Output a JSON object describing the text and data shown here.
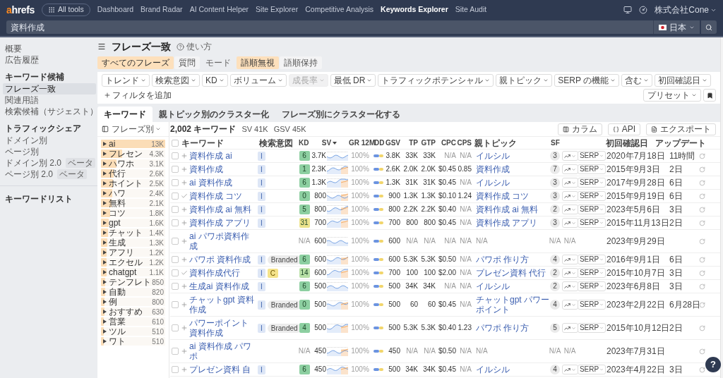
{
  "nav": {
    "logo": {
      "accent": "a",
      "rest": "hrefs"
    },
    "all_tools": "All tools",
    "links": [
      {
        "label": "Dashboard",
        "selected": false
      },
      {
        "label": "Brand Radar",
        "selected": false
      },
      {
        "label": "AI Content Helper",
        "selected": false
      },
      {
        "label": "Site Explorer",
        "selected": false
      },
      {
        "label": "Competitive Analysis",
        "selected": false
      },
      {
        "label": "Keywords Explorer",
        "selected": true
      },
      {
        "label": "Site Audit",
        "selected": false
      }
    ],
    "account": "株式会社Cone"
  },
  "search": {
    "value": "資料作成",
    "country": "日本"
  },
  "sidebar": {
    "items": [
      {
        "label": "概要",
        "selected": false
      },
      {
        "label": "広告履歴",
        "selected": false
      }
    ],
    "sections": [
      {
        "heading": "キーワード候補",
        "items": [
          {
            "label": "フレーズ一致",
            "selected": true
          },
          {
            "label": "関連用語",
            "selected": false
          },
          {
            "label": "検索候補（サジェスト）",
            "selected": false
          }
        ]
      },
      {
        "heading": "トラフィックシェア",
        "items": [
          {
            "label": "ドメイン別",
            "selected": false
          },
          {
            "label": "ページ別",
            "selected": false
          },
          {
            "label": "ドメイン別 2.0",
            "badge": "ベータ",
            "selected": false
          },
          {
            "label": "ページ別 2.0",
            "badge": "ベータ",
            "selected": false
          }
        ]
      },
      {
        "heading": "キーワードリスト"
      }
    ]
  },
  "page": {
    "title": "フレーズ一致",
    "help": "使い方"
  },
  "match_toggle": [
    {
      "label": "すべてのフレーズ",
      "selected": true
    },
    {
      "label": "質問",
      "selected": false
    }
  ],
  "mode_label": "モード",
  "order_toggle": [
    {
      "label": "語順無視",
      "selected": true
    },
    {
      "label": "語順保持",
      "selected": false
    }
  ],
  "filters": [
    {
      "label": "トレンド",
      "disabled": false
    },
    {
      "label": "検索意図",
      "disabled": false
    },
    {
      "label": "KD",
      "disabled": false
    },
    {
      "label": "ボリューム",
      "disabled": false
    },
    {
      "label": "成長率",
      "disabled": true
    },
    {
      "label": "最低 DR",
      "disabled": false
    },
    {
      "label": "トラフィックポテンシャル",
      "disabled": false
    },
    {
      "label": "親トピック",
      "disabled": false
    },
    {
      "label": "SERP の機能",
      "disabled": false
    },
    {
      "label": "含む",
      "disabled": false
    },
    {
      "label": "初回確認日",
      "disabled": false
    }
  ],
  "add_filter": "フィルタを追加",
  "preset": "プリセット",
  "tabs": [
    {
      "label": "キーワード",
      "selected": true
    },
    {
      "label": "親トピック別のクラスター化",
      "selected": false
    },
    {
      "label": "フレーズ別にクラスター化する",
      "selected": false
    }
  ],
  "phrase_panel": {
    "header": "フレーズ別",
    "items": [
      {
        "label": "ai",
        "count": "13K",
        "level": 1
      },
      {
        "label": "フレセン",
        "count": "4.3K",
        "level": 0.33
      },
      {
        "label": "ハワホ",
        "count": "3.1K",
        "level": 0.24
      },
      {
        "label": "代行",
        "count": "2.6K",
        "level": 0.2
      },
      {
        "label": "ホイント",
        "count": "2.5K",
        "level": 0.19
      },
      {
        "label": "ハワ",
        "count": "2.4K",
        "level": 0.18
      },
      {
        "label": "無料",
        "count": "2.1K",
        "level": 0.16
      },
      {
        "label": "コツ",
        "count": "1.8K",
        "level": 0.14
      },
      {
        "label": "gpt",
        "count": "1.6K",
        "level": 0.12
      },
      {
        "label": "チャット",
        "count": "1.4K",
        "level": 0.11
      },
      {
        "label": "生成",
        "count": "1.3K",
        "level": 0.1
      },
      {
        "label": "アフリ",
        "count": "1.2K",
        "level": 0.09
      },
      {
        "label": "エクセル",
        "count": "1.2K",
        "level": 0.09
      },
      {
        "label": "chatgpt",
        "count": "1.1K",
        "level": 0.085
      },
      {
        "label": "テンフレト",
        "count": "850",
        "level": 0.065
      },
      {
        "label": "自動",
        "count": "820",
        "level": 0.063
      },
      {
        "label": "例",
        "count": "800",
        "level": 0.06
      },
      {
        "label": "おすすめ",
        "count": "630",
        "level": 0.05
      },
      {
        "label": "営業",
        "count": "610",
        "level": 0.047
      },
      {
        "label": "ツル",
        "count": "510",
        "level": 0.04
      },
      {
        "label": "ワト",
        "count": "510",
        "level": 0.04
      }
    ]
  },
  "table": {
    "select_all": {
      "checked": false
    },
    "summary": {
      "count": "2,002 キーワード",
      "sv": "SV 41K",
      "gsv": "GSV 45K"
    },
    "buttons": [
      {
        "label": "カラム",
        "kind": "columns"
      },
      {
        "label": "API",
        "kind": "api"
      },
      {
        "label": "エクスポート",
        "kind": "export"
      }
    ],
    "columns": [
      {
        "label": "キーワード",
        "sorted": false
      },
      {
        "label": "検索意図",
        "sorted": false
      },
      {
        "label": "KD",
        "sorted": false
      },
      {
        "label": "SV",
        "sorted": true
      },
      {
        "label": "GR 12M",
        "sorted": false
      },
      {
        "label": "DD",
        "sorted": false
      },
      {
        "label": "GSV",
        "sorted": false
      },
      {
        "label": "TP",
        "sorted": false
      },
      {
        "label": "GTP",
        "sorted": false
      },
      {
        "label": "CPC",
        "sorted": false
      },
      {
        "label": "CPS",
        "sorted": false
      },
      {
        "label": "親トピック",
        "sorted": false
      },
      {
        "label": "SF",
        "sorted": false
      },
      {
        "label": "初回確認日",
        "sorted": false
      },
      {
        "label": "アップデート",
        "sorted": false
      }
    ],
    "rows": [
      {
        "checked": false,
        "added": false,
        "keyword": "資料作成 ai",
        "intents": [
          {
            "label": "I",
            "kind": "informational"
          }
        ],
        "kd": {
          "value": "6",
          "color": "#8dcfa1"
        },
        "sv": "3.7K",
        "forecast": false,
        "gr12m": "100%",
        "gsv": "3.8K",
        "tp": "33K",
        "gtp": "33K",
        "cpc": "N/A",
        "cps": "N/A",
        "parent_topic": "イルシル",
        "sf": "3",
        "serp": "SERP",
        "first_seen": "2020年7月18日",
        "updated": "11時間",
        "muted": {
          "cpc": true,
          "cps": true
        }
      },
      {
        "checked": false,
        "added": false,
        "keyword": "資料作成",
        "intents": [
          {
            "label": "I",
            "kind": "informational"
          }
        ],
        "kd": {
          "value": "1",
          "color": "#8dcfa1"
        },
        "sv": "2.3K",
        "forecast": true,
        "gr12m": "100%",
        "gsv": "2.6K",
        "tp": "2.0K",
        "gtp": "2.0K",
        "cpc": "$0.45",
        "cps": "0.85",
        "parent_topic": "資料作成",
        "sf": "7",
        "serp": "SERP",
        "first_seen": "2015年9月3日",
        "updated": "2日"
      },
      {
        "checked": false,
        "added": false,
        "keyword": "ai 資料作成",
        "intents": [
          {
            "label": "I",
            "kind": "informational"
          }
        ],
        "kd": {
          "value": "6",
          "color": "#8dcfa1"
        },
        "sv": "1.3K",
        "forecast": true,
        "gr12m": "100%",
        "gsv": "1.3K",
        "tp": "31K",
        "gtp": "31K",
        "cpc": "$0.45",
        "cps": "N/A",
        "parent_topic": "イルシル",
        "sf": "3",
        "serp": "SERP",
        "first_seen": "2017年9月28日",
        "updated": "6日",
        "muted": {
          "cps": true
        }
      },
      {
        "checked": false,
        "added": true,
        "keyword": "資料作成 コツ",
        "intents": [
          {
            "label": "I",
            "kind": "informational"
          }
        ],
        "kd": {
          "value": "0",
          "color": "#8dcfa1"
        },
        "sv": "800",
        "forecast": true,
        "gr12m": "100%",
        "gsv": "900",
        "tp": "1.3K",
        "gtp": "1.3K",
        "cpc": "$0.10",
        "cps": "1.24",
        "parent_topic": "資料作成 コツ",
        "sf": "3",
        "serp": "SERP",
        "first_seen": "2015年9月19日",
        "updated": "6日"
      },
      {
        "checked": false,
        "added": false,
        "keyword": "資料作成 ai 無料",
        "intents": [
          {
            "label": "I",
            "kind": "informational"
          }
        ],
        "kd": {
          "value": "5",
          "color": "#8dcfa1"
        },
        "sv": "800",
        "forecast": true,
        "gr12m": "100%",
        "gsv": "800",
        "tp": "2.2K",
        "gtp": "2.2K",
        "cpc": "$0.40",
        "cps": "N/A",
        "parent_topic": "資料作成 ai 無料",
        "sf": "2",
        "serp": "SERP",
        "first_seen": "2023年5月6日",
        "updated": "3日",
        "muted": {
          "cps": true
        }
      },
      {
        "checked": false,
        "added": false,
        "keyword": "資料作成 アプリ",
        "intents": [
          {
            "label": "I",
            "kind": "informational"
          }
        ],
        "kd": {
          "value": "31",
          "color": "#ece38c"
        },
        "sv": "700",
        "forecast": true,
        "gr12m": "100%",
        "gsv": "700",
        "tp": "800",
        "gtp": "800",
        "cpc": "$0.45",
        "cps": "N/A",
        "parent_topic": "資料作成 アプリ",
        "sf": "3",
        "serp": "SERP",
        "first_seen": "2015年11月13日",
        "updated": "2日",
        "muted": {
          "cps": true
        }
      },
      {
        "checked": false,
        "added": false,
        "keyword": "ai パワポ資料作成",
        "kd": {
          "value": "N/A"
        },
        "sv": "600",
        "forecast": false,
        "gr12m": "100%",
        "gsv": "600",
        "tp": "N/A",
        "gtp": "N/A",
        "cpc": "N/A",
        "cps": "N/A",
        "parent_topic": "N/A",
        "sf": "N/A",
        "trend_text": "N/A",
        "first_seen": "2023年9月29日",
        "muted": {
          "tp": true,
          "gtp": true,
          "cpc": true,
          "cps": true,
          "parent_topic": true,
          "sf": true
        }
      },
      {
        "checked": false,
        "added": false,
        "keyword": "パワポ 資料作成",
        "intents": [
          {
            "label": "I",
            "kind": "informational"
          },
          {
            "label": "Branded",
            "kind": "branded"
          }
        ],
        "kd": {
          "value": "6",
          "color": "#8dcfa1"
        },
        "sv": "600",
        "forecast": true,
        "gr12m": "100%",
        "gsv": "600",
        "tp": "5.3K",
        "gtp": "5.3K",
        "cpc": "$0.50",
        "cps": "N/A",
        "parent_topic": "パワポ 作り方",
        "sf": "4",
        "serp": "SERP",
        "first_seen": "2016年9月1日",
        "updated": "6日",
        "muted": {
          "cps": true
        }
      },
      {
        "checked": false,
        "added": true,
        "keyword": "資料作成代行",
        "intents": [
          {
            "label": "I",
            "kind": "informational"
          },
          {
            "label": "C",
            "kind": "commercial"
          }
        ],
        "kd": {
          "value": "14",
          "color": "#b8e0a6"
        },
        "sv": "600",
        "forecast": true,
        "gr12m": "100%",
        "gsv": "700",
        "tp": "100",
        "gtp": "100",
        "cpc": "$2.00",
        "cps": "N/A",
        "parent_topic": "プレゼン資料 代行",
        "sf": "2",
        "serp": "SERP",
        "first_seen": "2015年10月7日",
        "updated": "3日",
        "muted": {
          "cps": true
        }
      },
      {
        "checked": false,
        "added": false,
        "keyword": "生成ai 資料作成",
        "intents": [
          {
            "label": "I",
            "kind": "informational"
          }
        ],
        "kd": {
          "value": "6",
          "color": "#8dcfa1"
        },
        "sv": "500",
        "forecast": false,
        "gr12m": "100%",
        "gsv": "500",
        "tp": "34K",
        "gtp": "34K",
        "cpc": "N/A",
        "cps": "N/A",
        "parent_topic": "イルシル",
        "sf": "2",
        "serp": "SERP",
        "first_seen": "2023年6月8日",
        "updated": "3日",
        "muted": {
          "cpc": true,
          "cps": true
        }
      },
      {
        "checked": false,
        "added": false,
        "keyword": "チャットgpt 資料作成",
        "intents": [
          {
            "label": "I",
            "kind": "informational"
          },
          {
            "label": "Branded",
            "kind": "branded"
          }
        ],
        "kd": {
          "value": "0",
          "color": "#8dcfa1"
        },
        "sv": "500",
        "forecast": true,
        "gr12m": "100%",
        "gsv": "500",
        "tp": "60",
        "gtp": "60",
        "cpc": "$0.45",
        "cps": "N/A",
        "parent_topic": "チャットgpt パワーポイント",
        "sf": "4",
        "serp": "SERP",
        "first_seen": "2023年2月22日",
        "updated": "6月28日",
        "muted": {
          "cps": true
        }
      },
      {
        "checked": false,
        "added": false,
        "keyword": "パワーポイント資料作成",
        "intents": [
          {
            "label": "I",
            "kind": "informational"
          },
          {
            "label": "Branded",
            "kind": "branded"
          }
        ],
        "kd": {
          "value": "4",
          "color": "#8dcfa1"
        },
        "sv": "500",
        "forecast": true,
        "gr12m": "100%",
        "gsv": "500",
        "tp": "5.3K",
        "gtp": "5.3K",
        "cpc": "$0.40",
        "cps": "1.23",
        "parent_topic": "パワポ 作り方",
        "sf": "5",
        "serp": "SERP",
        "first_seen": "2015年10月12日",
        "updated": "2日"
      },
      {
        "checked": false,
        "added": false,
        "keyword": "ai 資料作成 パワポ",
        "kd": {
          "value": "N/A"
        },
        "sv": "450",
        "forecast": true,
        "gr12m": "100%",
        "gsv": "450",
        "tp": "N/A",
        "gtp": "N/A",
        "cpc": "$0.50",
        "cps": "N/A",
        "parent_topic": "N/A",
        "sf": "N/A",
        "trend_text": "N/A",
        "first_seen": "2023年7月31日",
        "muted": {
          "tp": true,
          "gtp": true,
          "cps": true,
          "parent_topic": true,
          "sf": true
        }
      },
      {
        "checked": false,
        "added": false,
        "keyword": "プレゼン資料 自",
        "intents": [
          {
            "label": "I",
            "kind": "informational"
          }
        ],
        "kd": {
          "value": "6",
          "color": "#8dcfa1"
        },
        "sv": "450",
        "forecast": true,
        "gr12m": "100%",
        "gsv": "500",
        "tp": "34K",
        "gtp": "34K",
        "cpc": "$0.45",
        "cps": "N/A",
        "parent_topic": "イルシル",
        "sf": "4",
        "serp": "SERP",
        "first_seen": "2023年4月22日",
        "updated": "3日",
        "muted": {
          "cps": true
        }
      }
    ]
  },
  "help_button": "?"
}
